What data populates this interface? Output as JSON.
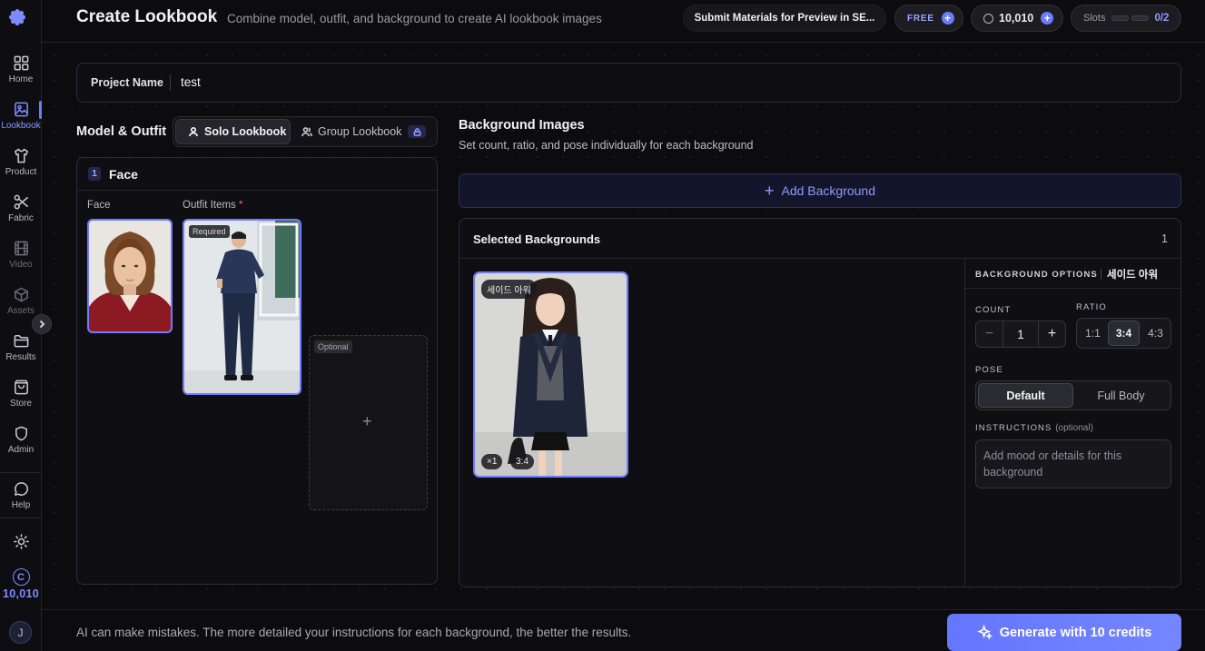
{
  "sidebar": {
    "items": [
      {
        "label": "Home",
        "icon": "grid-icon"
      },
      {
        "label": "Lookbook",
        "icon": "image-icon"
      },
      {
        "label": "Product",
        "icon": "shirt-icon"
      },
      {
        "label": "Fabric",
        "icon": "scissors-icon"
      },
      {
        "label": "Video",
        "icon": "film-icon"
      },
      {
        "label": "Assets",
        "icon": "cube-icon"
      },
      {
        "label": "Results",
        "icon": "folder-icon"
      },
      {
        "label": "Store",
        "icon": "bag-icon"
      },
      {
        "label": "Admin",
        "icon": "shield-icon"
      },
      {
        "label": "Help",
        "icon": "chat-icon"
      }
    ],
    "credits": "10,010",
    "credit_symbol": "C",
    "avatar_initial": "J"
  },
  "header": {
    "title": "Create Lookbook",
    "subtitle": "Combine model, outfit, and background to create AI lookbook images",
    "submit_label": "Submit Materials for Preview in SE...",
    "plan_label": "FREE",
    "credits": "10,010",
    "slots_label": "Slots",
    "slots_value": "0/2"
  },
  "project": {
    "label": "Project Name",
    "value": "test"
  },
  "model_outfit": {
    "title": "Model & Outfit",
    "tabs": [
      {
        "label": "Solo Lookbook"
      },
      {
        "label": "Group Lookbook"
      }
    ],
    "face_panel": {
      "number": "1",
      "title": "Face",
      "face_label": "Face",
      "outfit_label": "Outfit Items",
      "required_mark": "*",
      "required_tag": "Required",
      "optional_tag": "Optional",
      "add_symbol": "+"
    }
  },
  "backgrounds": {
    "title": "Background Images",
    "subtitle": "Set count, ratio, and pose individually for each background",
    "add_label": "Add Background",
    "selected_title": "Selected Backgrounds",
    "selected_count": "1",
    "card": {
      "name": "세이드 아워",
      "count_chip": "×1",
      "ratio_chip": "3:4"
    },
    "options": {
      "header": "BACKGROUND OPTIONS",
      "bg_name": "세이드 아워",
      "count_label": "COUNT",
      "count_value": "1",
      "ratio_label": "RATIO",
      "ratios": [
        "1:1",
        "3:4",
        "4:3"
      ],
      "ratio_selected": "3:4",
      "pose_label": "POSE",
      "poses": [
        "Default",
        "Full Body"
      ],
      "pose_selected": "Default",
      "instructions_label": "INSTRUCTIONS",
      "instructions_optional": "(optional)",
      "instructions_placeholder": "Add mood or details for this background"
    }
  },
  "footer": {
    "disclaimer": "AI can make mistakes. The more detailed your instructions for each background, the better the results.",
    "generate_label": "Generate with 10 credits"
  },
  "colors": {
    "accent": "#6b7bff",
    "background": "#0c0c0f",
    "panel": "#0f0f13"
  }
}
